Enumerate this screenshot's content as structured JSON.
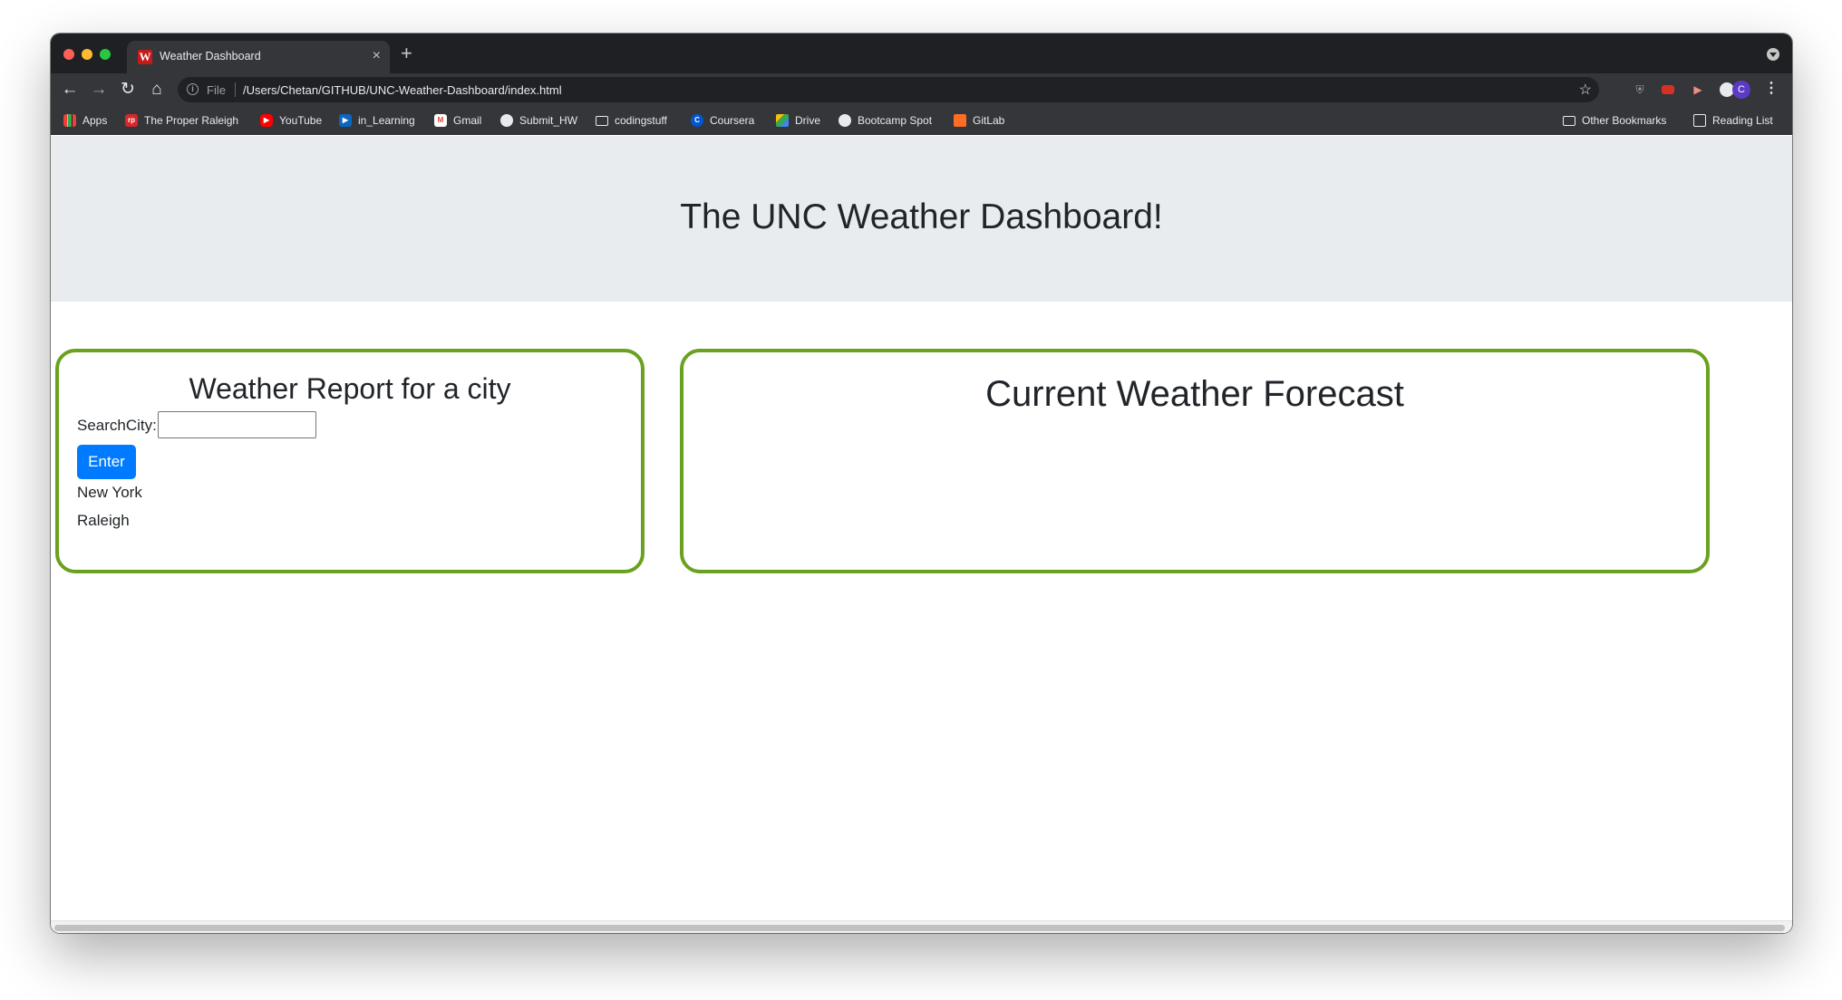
{
  "browser": {
    "tab_title": "Weather Dashboard",
    "tab_favicon_letter": "W",
    "new_tab_symbol": "+",
    "close_symbol": "×",
    "url_scheme": "File",
    "url_path": "/Users/Chetan/GITHUB/UNC-Weather-Dashboard/index.html",
    "avatar_letter": "C"
  },
  "bookmarks": {
    "items": [
      {
        "label": "Apps",
        "icon": "apps-grid-icon"
      },
      {
        "label": "The Proper Raleigh",
        "icon": "proper-raleigh-icon"
      },
      {
        "label": "YouTube",
        "icon": "youtube-icon"
      },
      {
        "label": "in_Learning",
        "icon": "linkedin-learning-icon"
      },
      {
        "label": "Gmail",
        "icon": "gmail-icon"
      },
      {
        "label": "Submit_HW",
        "icon": "globe-icon"
      },
      {
        "label": "codingstuff",
        "icon": "folder-icon"
      },
      {
        "label": "Coursera",
        "icon": "coursera-icon"
      },
      {
        "label": "Drive",
        "icon": "google-drive-icon"
      },
      {
        "label": "Bootcamp Spot",
        "icon": "globe-icon"
      },
      {
        "label": "GitLab",
        "icon": "gitlab-icon"
      }
    ],
    "other_bookmarks": "Other Bookmarks",
    "reading_list": "Reading List"
  },
  "page": {
    "title": "The UNC Weather Dashboard!",
    "search_panel": {
      "title": "Weather Report for a city",
      "search_label": "SearchCity:",
      "search_value": "",
      "enter_label": "Enter",
      "cities": [
        "New York",
        "Raleigh"
      ]
    },
    "forecast_panel": {
      "title": "Current Weather Forecast"
    }
  },
  "colors": {
    "card_border": "#6aa121",
    "button_primary": "#007bff",
    "jumbotron_bg": "#e9ecef"
  }
}
